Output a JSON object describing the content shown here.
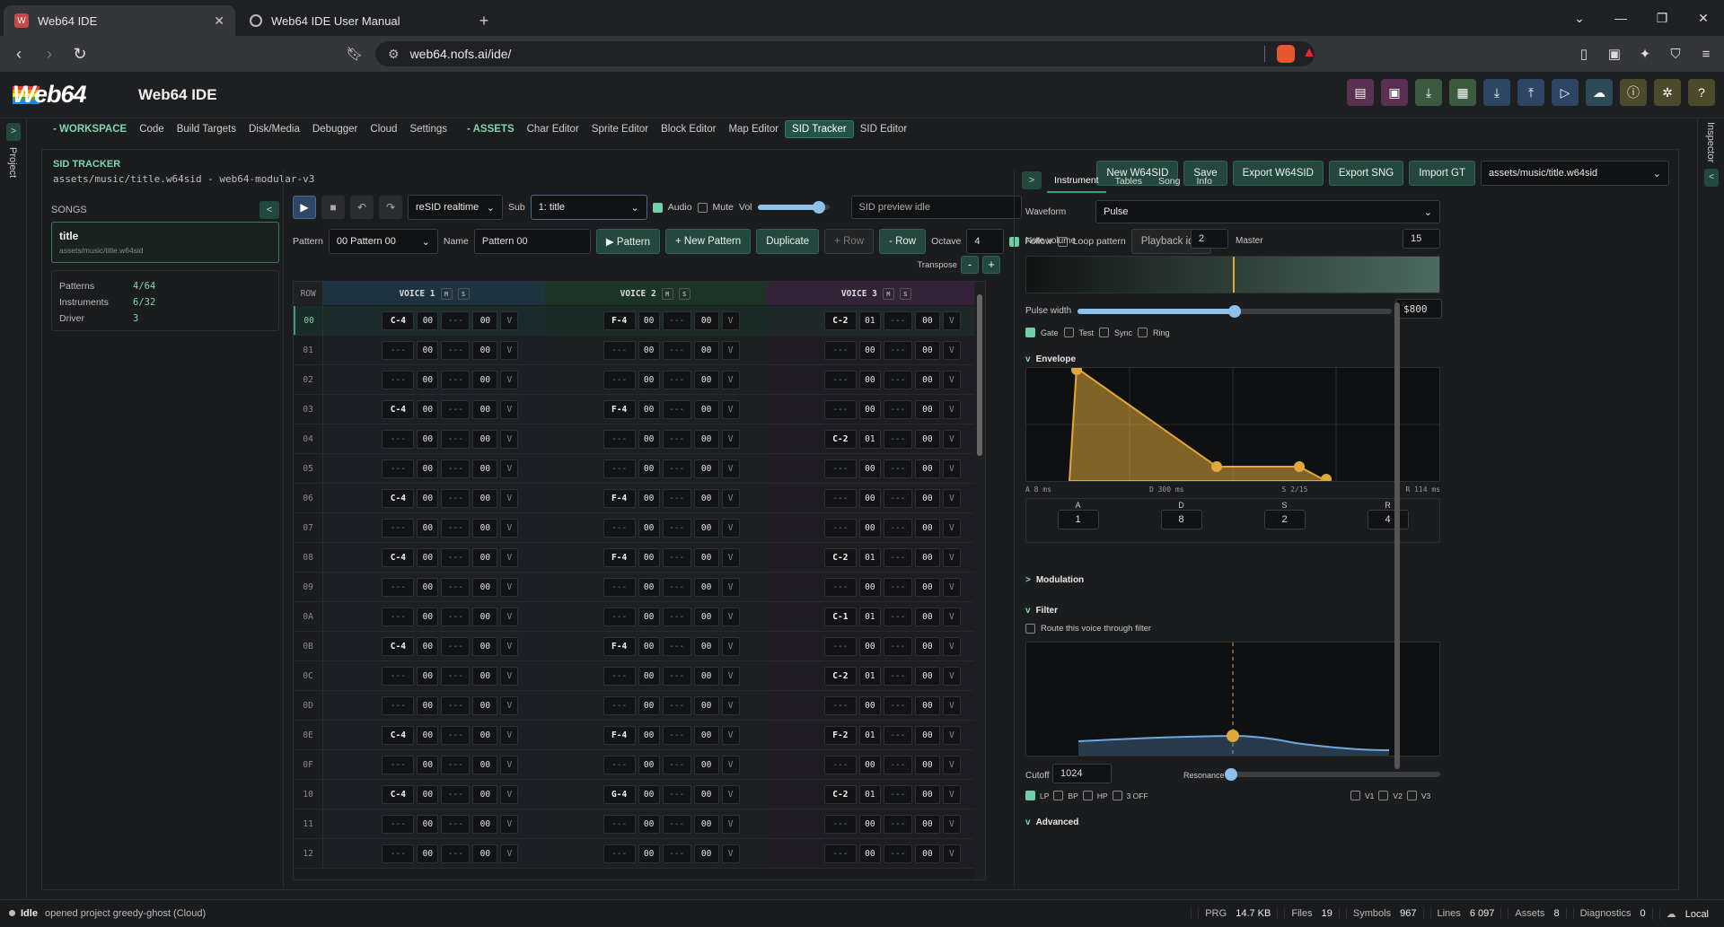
{
  "browser": {
    "tabs": [
      {
        "title": "Web64 IDE",
        "active": true
      },
      {
        "title": "Web64 IDE User Manual",
        "active": false
      }
    ],
    "url": "web64.nofs.ai/ide/"
  },
  "app": {
    "logo": "Web64",
    "title": "Web64 IDE"
  },
  "left_sidebar": {
    "label": "Project"
  },
  "right_sidebar": {
    "label": "Inspector"
  },
  "menu": {
    "workspace": "- WORKSPACE",
    "items1": [
      "Code",
      "Build Targets",
      "Disk/Media",
      "Debugger",
      "Cloud",
      "Settings"
    ],
    "assets": "- ASSETS",
    "items2": [
      "Char Editor",
      "Sprite Editor",
      "Block Editor",
      "Map Editor",
      "SID Tracker",
      "SID Editor"
    ],
    "active": "SID Tracker"
  },
  "panel": {
    "title": "SID TRACKER",
    "subtitle": "assets/music/title.w64sid - web64-modular-v3",
    "buttons": [
      "New W64SID",
      "Save",
      "Export W64SID",
      "Export SNG",
      "Import GT"
    ],
    "file_select": "assets/music/title.w64sid"
  },
  "songs": {
    "header": "SONGS",
    "collapse": "<",
    "song_name": "title",
    "song_path": "assets/music/title.w64sid",
    "info": [
      {
        "k": "Patterns",
        "v": "4/64"
      },
      {
        "k": "Instruments",
        "v": "6/32"
      },
      {
        "k": "Driver",
        "v": "3"
      }
    ]
  },
  "toolbar": {
    "engine": "reSID realtime",
    "sub_label": "Sub",
    "sub_value": "1: title",
    "audio": "Audio",
    "mute": "Mute",
    "vol": "Vol",
    "volume": 0.85,
    "preview": "SID preview idle",
    "pattern_label": "Pattern",
    "pattern_value": "00 Pattern 00",
    "name_label": "Name",
    "name_value": "Pattern 00",
    "play_pattern": "▶ Pattern",
    "new_pattern": "+ New Pattern",
    "duplicate": "Duplicate",
    "add_row": "+ Row",
    "del_row": "- Row",
    "octave_label": "Octave",
    "octave_value": "4",
    "follow": "Follow",
    "loop": "Loop pattern",
    "playback": "Playback idle",
    "transpose": "Transpose",
    "minus": "-",
    "plus": "+"
  },
  "tracker": {
    "row_header": "ROW",
    "voices": [
      "VOICE 1",
      "VOICE 2",
      "VOICE 3"
    ],
    "voice_colors": [
      "#1d3340",
      "#1c3328",
      "#332238"
    ],
    "empty_note": "---",
    "empty_fx": "---",
    "vol": "V",
    "rows": [
      {
        "r": "00",
        "n": [
          "C-4",
          "F-4",
          "C-2"
        ],
        "i": [
          "00",
          "00",
          "01"
        ]
      },
      {
        "r": "01",
        "n": [
          "---",
          "---",
          "---"
        ],
        "i": [
          "00",
          "00",
          "00"
        ]
      },
      {
        "r": "02",
        "n": [
          "---",
          "---",
          "---"
        ],
        "i": [
          "00",
          "00",
          "00"
        ]
      },
      {
        "r": "03",
        "n": [
          "C-4",
          "F-4",
          "---"
        ],
        "i": [
          "00",
          "00",
          "00"
        ]
      },
      {
        "r": "04",
        "n": [
          "---",
          "---",
          "C-2"
        ],
        "i": [
          "00",
          "00",
          "01"
        ]
      },
      {
        "r": "05",
        "n": [
          "---",
          "---",
          "---"
        ],
        "i": [
          "00",
          "00",
          "00"
        ]
      },
      {
        "r": "06",
        "n": [
          "C-4",
          "F-4",
          "---"
        ],
        "i": [
          "00",
          "00",
          "00"
        ]
      },
      {
        "r": "07",
        "n": [
          "---",
          "---",
          "---"
        ],
        "i": [
          "00",
          "00",
          "00"
        ]
      },
      {
        "r": "08",
        "n": [
          "C-4",
          "F-4",
          "C-2"
        ],
        "i": [
          "00",
          "00",
          "01"
        ]
      },
      {
        "r": "09",
        "n": [
          "---",
          "---",
          "---"
        ],
        "i": [
          "00",
          "00",
          "00"
        ]
      },
      {
        "r": "0A",
        "n": [
          "---",
          "---",
          "C-1"
        ],
        "i": [
          "00",
          "00",
          "01"
        ]
      },
      {
        "r": "0B",
        "n": [
          "C-4",
          "F-4",
          "---"
        ],
        "i": [
          "00",
          "00",
          "00"
        ]
      },
      {
        "r": "0C",
        "n": [
          "---",
          "---",
          "C-2"
        ],
        "i": [
          "00",
          "00",
          "01"
        ]
      },
      {
        "r": "0D",
        "n": [
          "---",
          "---",
          "---"
        ],
        "i": [
          "00",
          "00",
          "00"
        ]
      },
      {
        "r": "0E",
        "n": [
          "C-4",
          "F-4",
          "F-2"
        ],
        "i": [
          "00",
          "00",
          "01"
        ]
      },
      {
        "r": "0F",
        "n": [
          "---",
          "---",
          "---"
        ],
        "i": [
          "00",
          "00",
          "00"
        ]
      },
      {
        "r": "10",
        "n": [
          "C-4",
          "G-4",
          "C-2"
        ],
        "i": [
          "00",
          "00",
          "01"
        ]
      },
      {
        "r": "11",
        "n": [
          "---",
          "---",
          "---"
        ],
        "i": [
          "00",
          "00",
          "00"
        ]
      },
      {
        "r": "12",
        "n": [
          "---",
          "---",
          "---"
        ],
        "i": [
          "00",
          "00",
          "00"
        ]
      }
    ],
    "param": "00"
  },
  "inspector": {
    "collapse": ">",
    "tabs": [
      "Instrument",
      "Tables",
      "Song",
      "Info"
    ],
    "active_tab": "Instrument",
    "waveform_label": "Waveform",
    "waveform": "Pulse",
    "note_volume_label": "Note volume",
    "note_volume": "2",
    "master_label": "Master",
    "master": "15",
    "pulse_width_label": "Pulse width",
    "pulse_width": "$800",
    "pulse_fraction": 0.5,
    "gate": "Gate",
    "test": "Test",
    "sync": "Sync",
    "ring": "Ring",
    "envelope": "Envelope",
    "env_labels": [
      "A 8 ms",
      "D 300 ms",
      "S 2/15",
      "R 114 ms"
    ],
    "adsr_heads": [
      "A",
      "D",
      "S",
      "R"
    ],
    "adsr": [
      "1",
      "8",
      "2",
      "4"
    ],
    "modulation": "Modulation",
    "filter": "Filter",
    "route": "Route this voice through filter",
    "cutoff_label": "Cutoff",
    "cutoff": "1024",
    "resonance_label": "Resonance",
    "modes": [
      "LP",
      "BP",
      "HP",
      "3 OFF"
    ],
    "voices": [
      "V1",
      "V2",
      "V3"
    ],
    "advanced": "Advanced",
    "accent": "#e0a838"
  },
  "status": {
    "state": "Idle",
    "message": "opened project greedy-ghost (Cloud)",
    "items": [
      {
        "k": "PRG",
        "v": "14.7 KB"
      },
      {
        "k": "Files",
        "v": "19"
      },
      {
        "k": "Symbols",
        "v": "967"
      },
      {
        "k": "Lines",
        "v": "6 097"
      },
      {
        "k": "Assets",
        "v": "8"
      },
      {
        "k": "Diagnostics",
        "v": "0"
      }
    ],
    "location": "Local"
  }
}
